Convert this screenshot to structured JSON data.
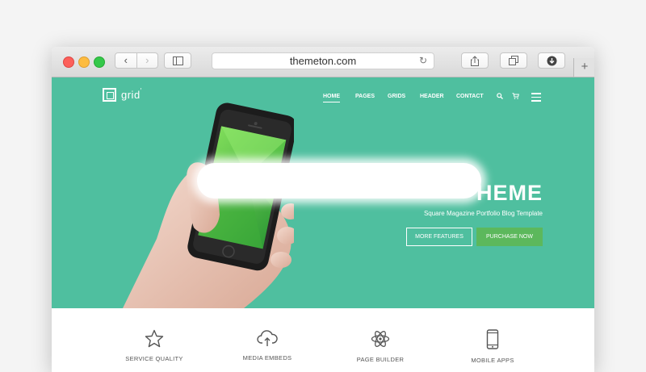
{
  "browser": {
    "url": "themeton.com",
    "new_tab_label": "+"
  },
  "site": {
    "logo_text": "grid",
    "logo_mark": "′",
    "nav": [
      {
        "label": "HOME",
        "active": true
      },
      {
        "label": "PAGES"
      },
      {
        "label": "GRIDS"
      },
      {
        "label": "HEADER"
      },
      {
        "label": "CONTACT"
      }
    ],
    "hero": {
      "title_visible_part": "HEME",
      "subtitle": "Square Magazine Portfolio Blog Template",
      "btn_more": "MORE FEATURES",
      "btn_purchase": "PURCHASE NOW"
    },
    "features": [
      {
        "label": "SERVICE QUALITY",
        "icon": "star-icon"
      },
      {
        "label": "MEDIA EMBEDS",
        "icon": "cloud-upload-icon"
      },
      {
        "label": "PAGE BUILDER",
        "icon": "atom-icon"
      },
      {
        "label": "MOBILE APPS",
        "icon": "mobile-icon"
      }
    ]
  },
  "colors": {
    "hero_bg": "#4fbf9f",
    "purchase_btn": "#5cb85c"
  }
}
